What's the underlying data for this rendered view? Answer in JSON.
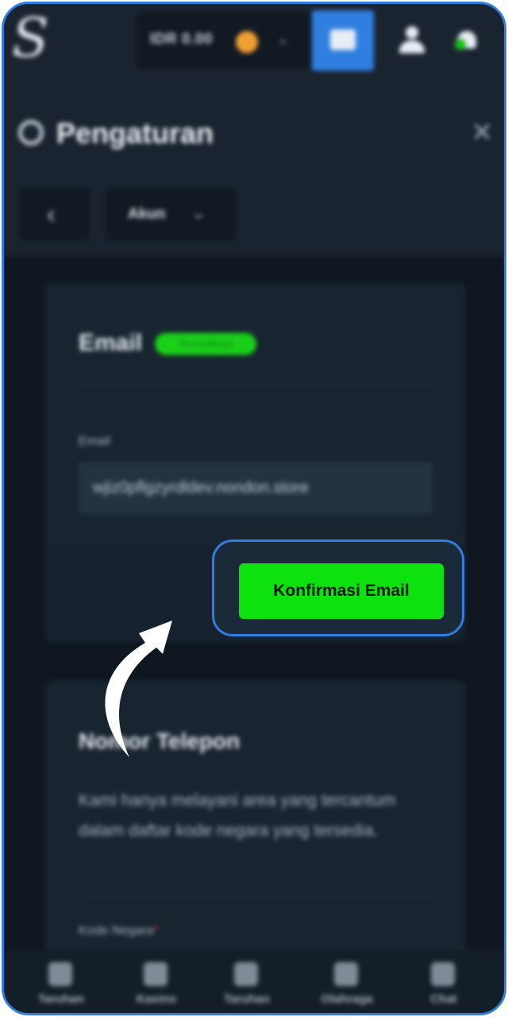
{
  "header": {
    "logo_text": "S",
    "balance": "IDR 0.00"
  },
  "settings": {
    "title": "Pengaturan",
    "close_glyph": "✕",
    "back_glyph": "‹",
    "section_select": "Akun"
  },
  "email_card": {
    "title": "Email",
    "badge": "Terverifikasi",
    "field_label": "Email",
    "field_value": "wjiz0pflgzyrdldev.nondon.store",
    "confirm_label": "Konfirmasi Email"
  },
  "phone_card": {
    "title": "Nomor Telepon",
    "description": "Kami hanya melayani area yang tercantum dalam daftar kode negara yang tersedia.",
    "country_label": "Kode Negara",
    "required_mark": "*"
  },
  "navbar": {
    "items": [
      {
        "label": "Taruhan",
        "icon": "slip-icon"
      },
      {
        "label": "Kasino",
        "icon": "diamond-icon"
      },
      {
        "label": "Taruhan",
        "icon": "dice-icon"
      },
      {
        "label": "Olahraga",
        "icon": "ball-icon"
      },
      {
        "label": "Chat",
        "icon": "chat-icon"
      }
    ]
  },
  "colors": {
    "accent_blue": "#2f7fe0",
    "confirm_green": "#0ee20e",
    "background": "#1a2430"
  }
}
